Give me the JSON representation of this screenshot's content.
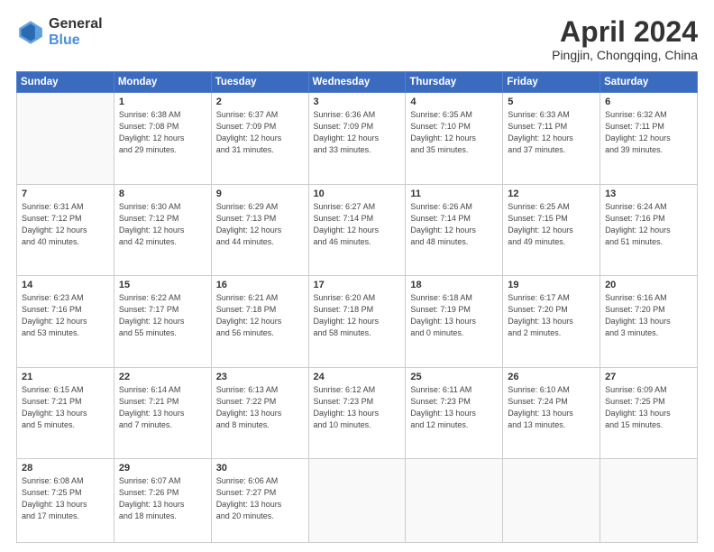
{
  "header": {
    "logo": {
      "general": "General",
      "blue": "Blue"
    },
    "title": "April 2024",
    "subtitle": "Pingjin, Chongqing, China"
  },
  "calendar": {
    "weekdays": [
      "Sunday",
      "Monday",
      "Tuesday",
      "Wednesday",
      "Thursday",
      "Friday",
      "Saturday"
    ],
    "weeks": [
      [
        {
          "day": "",
          "empty": true
        },
        {
          "day": "1",
          "sunrise": "Sunrise: 6:38 AM",
          "sunset": "Sunset: 7:08 PM",
          "daylight": "Daylight: 12 hours and 29 minutes."
        },
        {
          "day": "2",
          "sunrise": "Sunrise: 6:37 AM",
          "sunset": "Sunset: 7:09 PM",
          "daylight": "Daylight: 12 hours and 31 minutes."
        },
        {
          "day": "3",
          "sunrise": "Sunrise: 6:36 AM",
          "sunset": "Sunset: 7:09 PM",
          "daylight": "Daylight: 12 hours and 33 minutes."
        },
        {
          "day": "4",
          "sunrise": "Sunrise: 6:35 AM",
          "sunset": "Sunset: 7:10 PM",
          "daylight": "Daylight: 12 hours and 35 minutes."
        },
        {
          "day": "5",
          "sunrise": "Sunrise: 6:33 AM",
          "sunset": "Sunset: 7:11 PM",
          "daylight": "Daylight: 12 hours and 37 minutes."
        },
        {
          "day": "6",
          "sunrise": "Sunrise: 6:32 AM",
          "sunset": "Sunset: 7:11 PM",
          "daylight": "Daylight: 12 hours and 39 minutes."
        }
      ],
      [
        {
          "day": "7",
          "sunrise": "Sunrise: 6:31 AM",
          "sunset": "Sunset: 7:12 PM",
          "daylight": "Daylight: 12 hours and 40 minutes."
        },
        {
          "day": "8",
          "sunrise": "Sunrise: 6:30 AM",
          "sunset": "Sunset: 7:12 PM",
          "daylight": "Daylight: 12 hours and 42 minutes."
        },
        {
          "day": "9",
          "sunrise": "Sunrise: 6:29 AM",
          "sunset": "Sunset: 7:13 PM",
          "daylight": "Daylight: 12 hours and 44 minutes."
        },
        {
          "day": "10",
          "sunrise": "Sunrise: 6:27 AM",
          "sunset": "Sunset: 7:14 PM",
          "daylight": "Daylight: 12 hours and 46 minutes."
        },
        {
          "day": "11",
          "sunrise": "Sunrise: 6:26 AM",
          "sunset": "Sunset: 7:14 PM",
          "daylight": "Daylight: 12 hours and 48 minutes."
        },
        {
          "day": "12",
          "sunrise": "Sunrise: 6:25 AM",
          "sunset": "Sunset: 7:15 PM",
          "daylight": "Daylight: 12 hours and 49 minutes."
        },
        {
          "day": "13",
          "sunrise": "Sunrise: 6:24 AM",
          "sunset": "Sunset: 7:16 PM",
          "daylight": "Daylight: 12 hours and 51 minutes."
        }
      ],
      [
        {
          "day": "14",
          "sunrise": "Sunrise: 6:23 AM",
          "sunset": "Sunset: 7:16 PM",
          "daylight": "Daylight: 12 hours and 53 minutes."
        },
        {
          "day": "15",
          "sunrise": "Sunrise: 6:22 AM",
          "sunset": "Sunset: 7:17 PM",
          "daylight": "Daylight: 12 hours and 55 minutes."
        },
        {
          "day": "16",
          "sunrise": "Sunrise: 6:21 AM",
          "sunset": "Sunset: 7:18 PM",
          "daylight": "Daylight: 12 hours and 56 minutes."
        },
        {
          "day": "17",
          "sunrise": "Sunrise: 6:20 AM",
          "sunset": "Sunset: 7:18 PM",
          "daylight": "Daylight: 12 hours and 58 minutes."
        },
        {
          "day": "18",
          "sunrise": "Sunrise: 6:18 AM",
          "sunset": "Sunset: 7:19 PM",
          "daylight": "Daylight: 13 hours and 0 minutes."
        },
        {
          "day": "19",
          "sunrise": "Sunrise: 6:17 AM",
          "sunset": "Sunset: 7:20 PM",
          "daylight": "Daylight: 13 hours and 2 minutes."
        },
        {
          "day": "20",
          "sunrise": "Sunrise: 6:16 AM",
          "sunset": "Sunset: 7:20 PM",
          "daylight": "Daylight: 13 hours and 3 minutes."
        }
      ],
      [
        {
          "day": "21",
          "sunrise": "Sunrise: 6:15 AM",
          "sunset": "Sunset: 7:21 PM",
          "daylight": "Daylight: 13 hours and 5 minutes."
        },
        {
          "day": "22",
          "sunrise": "Sunrise: 6:14 AM",
          "sunset": "Sunset: 7:21 PM",
          "daylight": "Daylight: 13 hours and 7 minutes."
        },
        {
          "day": "23",
          "sunrise": "Sunrise: 6:13 AM",
          "sunset": "Sunset: 7:22 PM",
          "daylight": "Daylight: 13 hours and 8 minutes."
        },
        {
          "day": "24",
          "sunrise": "Sunrise: 6:12 AM",
          "sunset": "Sunset: 7:23 PM",
          "daylight": "Daylight: 13 hours and 10 minutes."
        },
        {
          "day": "25",
          "sunrise": "Sunrise: 6:11 AM",
          "sunset": "Sunset: 7:23 PM",
          "daylight": "Daylight: 13 hours and 12 minutes."
        },
        {
          "day": "26",
          "sunrise": "Sunrise: 6:10 AM",
          "sunset": "Sunset: 7:24 PM",
          "daylight": "Daylight: 13 hours and 13 minutes."
        },
        {
          "day": "27",
          "sunrise": "Sunrise: 6:09 AM",
          "sunset": "Sunset: 7:25 PM",
          "daylight": "Daylight: 13 hours and 15 minutes."
        }
      ],
      [
        {
          "day": "28",
          "sunrise": "Sunrise: 6:08 AM",
          "sunset": "Sunset: 7:25 PM",
          "daylight": "Daylight: 13 hours and 17 minutes."
        },
        {
          "day": "29",
          "sunrise": "Sunrise: 6:07 AM",
          "sunset": "Sunset: 7:26 PM",
          "daylight": "Daylight: 13 hours and 18 minutes."
        },
        {
          "day": "30",
          "sunrise": "Sunrise: 6:06 AM",
          "sunset": "Sunset: 7:27 PM",
          "daylight": "Daylight: 13 hours and 20 minutes."
        },
        {
          "day": "",
          "empty": true
        },
        {
          "day": "",
          "empty": true
        },
        {
          "day": "",
          "empty": true
        },
        {
          "day": "",
          "empty": true
        }
      ]
    ]
  }
}
